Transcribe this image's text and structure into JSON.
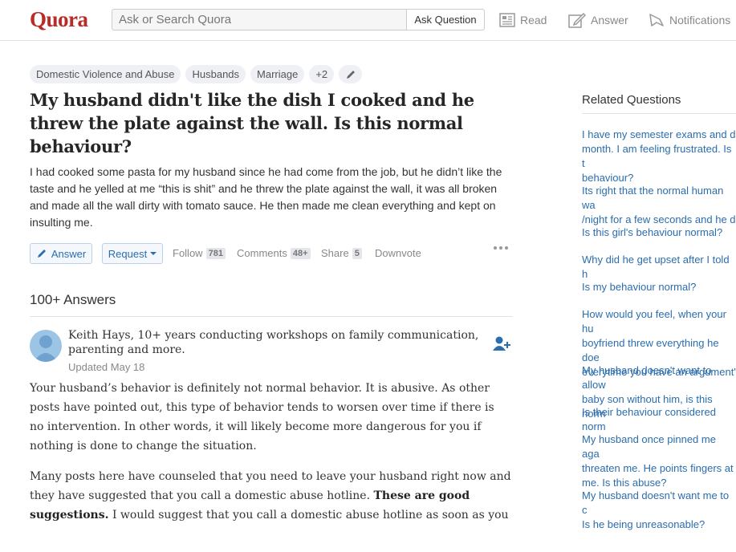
{
  "header": {
    "logo": "Quora",
    "search_placeholder": "Ask or Search Quora",
    "ask_button": "Ask Question",
    "nav": {
      "read": "Read",
      "answer": "Answer",
      "notifications": "Notifications"
    }
  },
  "question": {
    "tags": [
      "Domestic Violence and Abuse",
      "Husbands",
      "Marriage",
      "+2"
    ],
    "title": "My husband didn't like the dish I cooked and he threw the plate against the wall. Is this normal behaviour?",
    "details": "I had cooked some pasta for my husband since he had come from the job, but he didn’t like the taste and he yelled at me “this is shit” and he threw the plate against the wall, it was all broken and made all the wall dirty with tomato sauce. He then made me clean everything and kept on insulting me.",
    "actions": {
      "answer": "Answer",
      "request": "Request",
      "follow": "Follow",
      "follow_count": "781",
      "comments": "Comments",
      "comments_count": "48+",
      "share": "Share",
      "share_count": "5",
      "downvote": "Downvote"
    }
  },
  "answers": {
    "count_label": "100+ Answers",
    "first": {
      "author": "Keith Hays, 10+ years conducting workshops on family communication, parenting and more.",
      "updated": "Updated May 18",
      "para1": "Your husband’s behavior is definitely not normal behavior. It is abusive. As other posts have pointed out, this type of behavior tends to worsen over time if there is no intervention. In other words, it will likely become more dangerous for you if nothing is done to change the situation.",
      "para2_start": "Many posts here have counseled that you need to leave your husband right now and they have suggested that you call a domestic abuse hotline. ",
      "para2_bold": "These are good suggestions.",
      "para2_end": " I would suggest that you call a domestic abuse hotline as soon as you"
    }
  },
  "sidebar": {
    "title": "Related Questions",
    "items": [
      "I have my semester exams and d\nmonth. I am feeling frustrated. Is t\nbehaviour?",
      "Its right that the normal human wa\n/night for a few seconds and he d",
      "Is this girl's behaviour normal?",
      "Why did he get upset after I told h",
      "Is my behaviour normal?",
      "How would you feel, when your hu\nboyfriend threw everything he doe\neverytime you have an argument'",
      "My husband doesn't want to allow\nbaby son without him, is this norm",
      "Is their behaviour considered norm",
      "My husband once pinned me aga\nthreaten me. He points fingers at\nme. Is this abuse?",
      "My husband doesn't want me to c\nIs he being unreasonable?"
    ]
  },
  "colors": {
    "brand": "#b92b27",
    "link": "#2b6dad"
  }
}
